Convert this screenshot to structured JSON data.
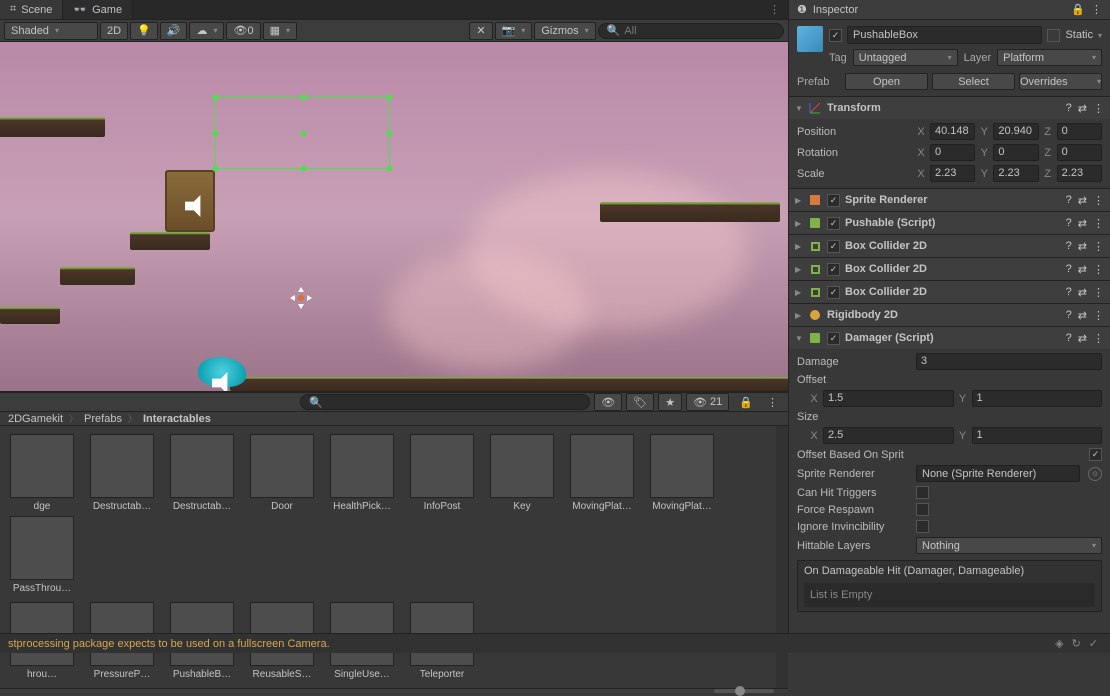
{
  "tabs": {
    "scene": "Scene",
    "game": "Game",
    "inspector": "Inspector"
  },
  "scene_toolbar": {
    "shading": "Shaded",
    "mode_2d": "2D",
    "gizmos": "Gizmos",
    "search_placeholder": "All",
    "eye_count": "21"
  },
  "breadcrumb": [
    "2DGamekit",
    "Prefabs",
    "Interactables"
  ],
  "assets_row1": [
    {
      "name": "dge"
    },
    {
      "name": "Destructab…"
    },
    {
      "name": "Destructab…"
    },
    {
      "name": "Door"
    },
    {
      "name": "HealthPick…"
    },
    {
      "name": "InfoPost"
    },
    {
      "name": "Key"
    },
    {
      "name": "MovingPlat…"
    },
    {
      "name": "MovingPlat…"
    },
    {
      "name": "PassThrou…"
    }
  ],
  "assets_row2": [
    {
      "name": "hrou…"
    },
    {
      "name": "PressureP…"
    },
    {
      "name": "PushableB…"
    },
    {
      "name": "ReusableS…"
    },
    {
      "name": "SingleUse…"
    },
    {
      "name": "Teleporter"
    }
  ],
  "inspector": {
    "name": "PushableBox",
    "static": "Static",
    "tag_label": "Tag",
    "tag": "Untagged",
    "layer_label": "Layer",
    "layer": "Platform",
    "prefab_label": "Prefab",
    "open": "Open",
    "select": "Select",
    "overrides": "Overrides"
  },
  "transform": {
    "title": "Transform",
    "position_label": "Position",
    "pos": {
      "x": "40.148",
      "y": "20.940",
      "z": "0"
    },
    "rotation_label": "Rotation",
    "rot": {
      "x": "0",
      "y": "0",
      "z": "0"
    },
    "scale_label": "Scale",
    "scale": {
      "x": "2.23",
      "y": "2.23",
      "z": "2.23"
    }
  },
  "components": [
    {
      "title": "Sprite Renderer",
      "icon": "sprite",
      "chk": true
    },
    {
      "title": "Pushable (Script)",
      "icon": "script",
      "chk": true
    },
    {
      "title": "Box Collider 2D",
      "icon": "box",
      "chk": true
    },
    {
      "title": "Box Collider 2D",
      "icon": "box",
      "chk": true
    },
    {
      "title": "Box Collider 2D",
      "icon": "box",
      "chk": true
    },
    {
      "title": "Rigidbody 2D",
      "icon": "rb",
      "chk": null
    }
  ],
  "damager": {
    "title": "Damager (Script)",
    "damage_label": "Damage",
    "damage": "3",
    "offset_label": "Offset",
    "offset": {
      "x": "1.5",
      "y": "1"
    },
    "size_label": "Size",
    "size": {
      "x": "2.5",
      "y": "1"
    },
    "offset_sprite_label": "Offset Based On Sprit",
    "offset_sprite": true,
    "sprite_renderer_label": "Sprite Renderer",
    "sprite_renderer": "None (Sprite Renderer)",
    "can_hit_label": "Can Hit Triggers",
    "force_respawn_label": "Force Respawn",
    "ignore_inv_label": "Ignore Invincibility",
    "hittable_label": "Hittable Layers",
    "hittable": "Nothing",
    "event_title": "On Damageable Hit (Damager, Damageable)",
    "event_empty": "List is Empty"
  },
  "footer": "stprocessing package expects to be used on a fullscreen Camera."
}
